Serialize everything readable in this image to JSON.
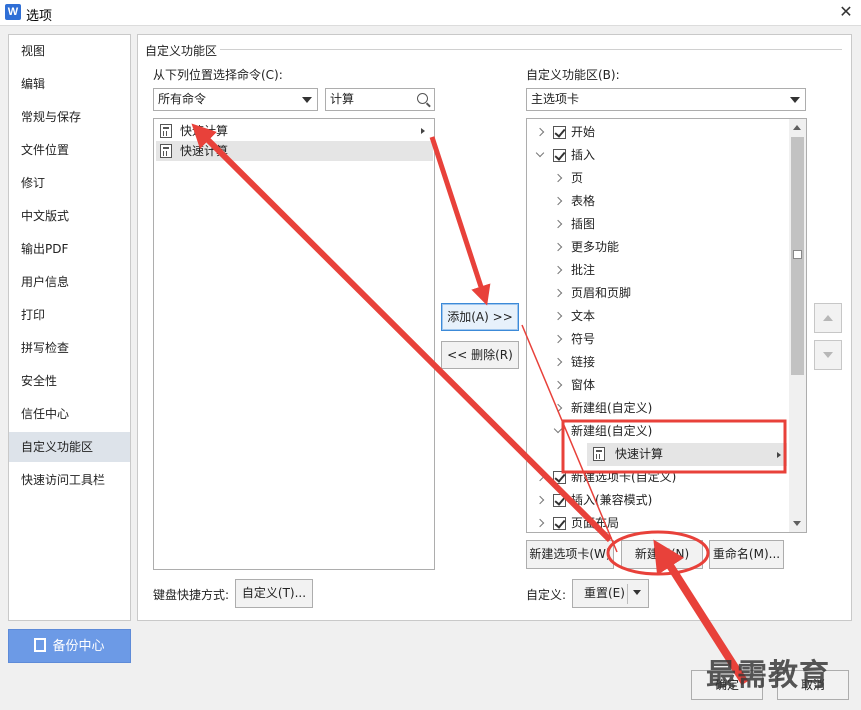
{
  "window": {
    "title": "选项",
    "app_icon_letter": "W"
  },
  "nav": {
    "items": [
      {
        "label": "视图"
      },
      {
        "label": "编辑"
      },
      {
        "label": "常规与保存"
      },
      {
        "label": "文件位置"
      },
      {
        "label": "修订"
      },
      {
        "label": "中文版式"
      },
      {
        "label": "输出PDF"
      },
      {
        "label": "用户信息"
      },
      {
        "label": "打印"
      },
      {
        "label": "拼写检查"
      },
      {
        "label": "安全性"
      },
      {
        "label": "信任中心"
      },
      {
        "label": "自定义功能区"
      },
      {
        "label": "快速访问工具栏"
      }
    ],
    "active_index": 12,
    "backup_label": "备份中心"
  },
  "main": {
    "group_title": "自定义功能区",
    "choose_from_label": "从下列位置选择命令(C):",
    "choose_from_value": "所有命令",
    "search_value": "计算",
    "commands": [
      {
        "label": "快速计算",
        "has_submenu": true,
        "selected": false
      },
      {
        "label": "快速计算",
        "has_submenu": false,
        "selected": true
      }
    ],
    "ribbon_label": "自定义功能区(B):",
    "ribbon_value": "主选项卡",
    "add_label": "添加(A) >>",
    "remove_label": "<< 删除(R)",
    "tree": [
      {
        "label": "开始",
        "level": 0,
        "expanded": false,
        "checkbox": true
      },
      {
        "label": "插入",
        "level": 0,
        "expanded": true,
        "checkbox": true
      },
      {
        "label": "页",
        "level": 1,
        "expanded": false,
        "checkbox": false
      },
      {
        "label": "表格",
        "level": 1,
        "expanded": false,
        "checkbox": false
      },
      {
        "label": "插图",
        "level": 1,
        "expanded": false,
        "checkbox": false
      },
      {
        "label": "更多功能",
        "level": 1,
        "expanded": false,
        "checkbox": false
      },
      {
        "label": "批注",
        "level": 1,
        "expanded": false,
        "checkbox": false
      },
      {
        "label": "页眉和页脚",
        "level": 1,
        "expanded": false,
        "checkbox": false
      },
      {
        "label": "文本",
        "level": 1,
        "expanded": false,
        "checkbox": false
      },
      {
        "label": "符号",
        "level": 1,
        "expanded": false,
        "checkbox": false
      },
      {
        "label": "链接",
        "level": 1,
        "expanded": false,
        "checkbox": false
      },
      {
        "label": "窗体",
        "level": 1,
        "expanded": false,
        "checkbox": false
      },
      {
        "label": "新建组(自定义)",
        "level": 1,
        "expanded": false,
        "checkbox": false
      },
      {
        "label": "新建组(自定义)",
        "level": 1,
        "expanded": true,
        "checkbox": false
      },
      {
        "label": "快速计算",
        "level": 2,
        "expanded": false,
        "checkbox": false,
        "selected": true,
        "has_submenu": true
      },
      {
        "label": "新建选项卡(自定义)",
        "level": 0,
        "expanded": false,
        "checkbox": true
      },
      {
        "label": "插入(兼容模式)",
        "level": 0,
        "expanded": false,
        "checkbox": true
      },
      {
        "label": "页面布局",
        "level": 0,
        "expanded": false,
        "checkbox": true
      }
    ],
    "new_tab_label": "新建选项卡(W)",
    "new_group_label": "新建组(N)",
    "rename_label": "重命名(M)...",
    "keyboard_label": "键盘快捷方式:",
    "keyboard_btn_label": "自定义(T)...",
    "customize_label": "自定义:",
    "reset_label": "重置(E)"
  },
  "footer": {
    "ok_label": "确定",
    "cancel_label": "取消"
  },
  "watermark": "最需教育",
  "colors": {
    "annotation_red": "#e8413a",
    "accent_blue": "#6c9ae6"
  }
}
